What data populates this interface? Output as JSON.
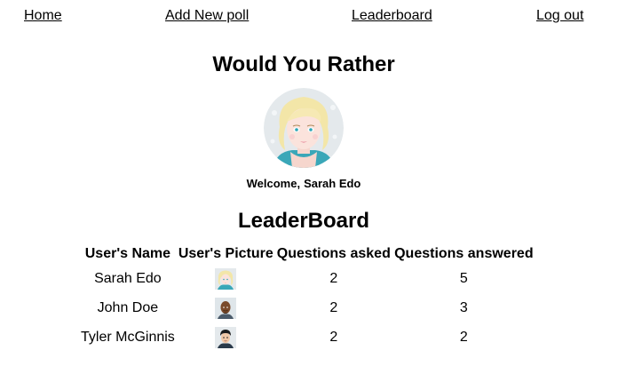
{
  "nav": {
    "home": "Home",
    "add_poll": "Add New poll",
    "leaderboard": "Leaderboard",
    "logout": "Log out"
  },
  "app": {
    "title": "Would You Rather"
  },
  "welcome": {
    "prefix": "Welcome,",
    "user_name": "Sarah Edo"
  },
  "leaderboard": {
    "title": "LeaderBoard",
    "columns": [
      "User's Name",
      "User's Picture",
      "Questions asked",
      "Questions answered"
    ],
    "rows": [
      {
        "name": "Sarah Edo",
        "avatar": "blonde-woman-avatar-icon",
        "asked": "2",
        "answered": "5"
      },
      {
        "name": "John Doe",
        "avatar": "bald-man-avatar-icon",
        "asked": "2",
        "answered": "3"
      },
      {
        "name": "Tyler McGinnis",
        "avatar": "dark-hair-man-avatar-icon",
        "asked": "2",
        "answered": "2"
      }
    ]
  },
  "colors": {
    "text": "#000000",
    "background": "#ffffff",
    "link": "#000000"
  }
}
